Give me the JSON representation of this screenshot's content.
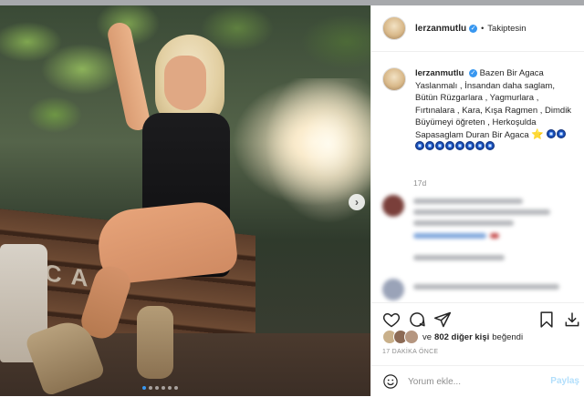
{
  "header": {
    "username": "lerzanmutlu",
    "separator": "•",
    "follow_status": "Takiptesin"
  },
  "caption": {
    "username": "lerzanmutlu",
    "text": "Bazen Bir Agaca Yaslanmalı , İnsandan daha saglam, Bütün Rüzgarlara , Yagmurlara , Fırtınalara , Kara, Kışa Ragmen , Dimdik Büyümeyi öğreten , Herkoşulda Sapasaglam Duran Bir Agaca",
    "star_emoji": "⭐",
    "eye_emoji_count": 10,
    "time_ago": "17d"
  },
  "likes": {
    "prefix": "ve",
    "count_text": "802 diğer kişi",
    "suffix": "beğendi"
  },
  "post_time": "17 DAKİKA ÖNCE",
  "comment_box": {
    "placeholder": "Yorum ekle...",
    "post_label": "Paylaş"
  },
  "carousel": {
    "total_slides": 6,
    "active_slide": 1
  },
  "photo_text": "ACA",
  "icons": [
    "heart-icon",
    "comment-icon",
    "share-icon",
    "bookmark-icon",
    "download-icon",
    "emoji-icon",
    "verified-icon",
    "next-arrow-icon"
  ],
  "colors": {
    "accent_blue": "#3897f0",
    "post_button_disabled": "#b2dffc",
    "text": "#262626",
    "muted": "#8e8e8e"
  }
}
